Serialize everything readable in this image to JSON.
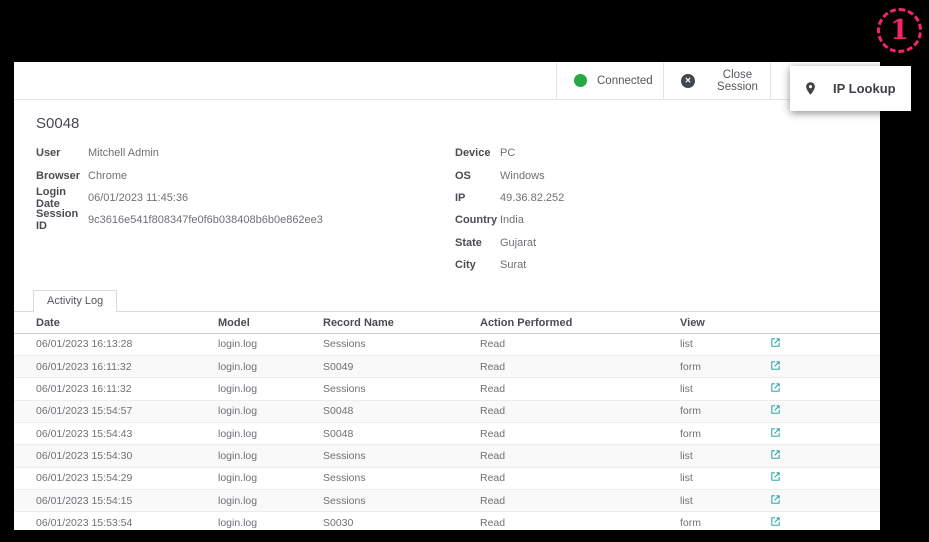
{
  "annotation": {
    "number": "1"
  },
  "toolbar": {
    "connected_label": "Connected",
    "close_session_label": "Close Session",
    "ip_lookup_label": "IP Lookup"
  },
  "popup": {
    "ip_lookup_label": "IP Lookup"
  },
  "session": {
    "title": "S0048",
    "fields_left": [
      {
        "label": "User",
        "value": "Mitchell Admin"
      },
      {
        "label": "Browser",
        "value": "Chrome"
      },
      {
        "label": "Login Date",
        "value": "06/01/2023 11:45:36"
      },
      {
        "label": "Session ID",
        "value": "9c3616e541f808347fe0f6b038408b6b0e862ee3"
      }
    ],
    "fields_right": [
      {
        "label": "Device",
        "value": "PC"
      },
      {
        "label": "OS",
        "value": "Windows"
      },
      {
        "label": "IP",
        "value": "49.36.82.252"
      },
      {
        "label": "Country",
        "value": "India"
      },
      {
        "label": "State",
        "value": "Gujarat"
      },
      {
        "label": "City",
        "value": "Surat"
      }
    ]
  },
  "tabs": {
    "activity_log_label": "Activity Log"
  },
  "activity_log": {
    "columns": {
      "date": "Date",
      "model": "Model",
      "record_name": "Record Name",
      "action_performed": "Action Performed",
      "view": "View"
    },
    "rows": [
      {
        "date": "06/01/2023 16:13:28",
        "model": "login.log",
        "record_name": "Sessions",
        "action": "Read",
        "view": "list"
      },
      {
        "date": "06/01/2023 16:11:32",
        "model": "login.log",
        "record_name": "S0049",
        "action": "Read",
        "view": "form"
      },
      {
        "date": "06/01/2023 16:11:32",
        "model": "login.log",
        "record_name": "Sessions",
        "action": "Read",
        "view": "list"
      },
      {
        "date": "06/01/2023 15:54:57",
        "model": "login.log",
        "record_name": "S0048",
        "action": "Read",
        "view": "form"
      },
      {
        "date": "06/01/2023 15:54:43",
        "model": "login.log",
        "record_name": "S0048",
        "action": "Read",
        "view": "form"
      },
      {
        "date": "06/01/2023 15:54:30",
        "model": "login.log",
        "record_name": "Sessions",
        "action": "Read",
        "view": "list"
      },
      {
        "date": "06/01/2023 15:54:29",
        "model": "login.log",
        "record_name": "Sessions",
        "action": "Read",
        "view": "list"
      },
      {
        "date": "06/01/2023 15:54:15",
        "model": "login.log",
        "record_name": "Sessions",
        "action": "Read",
        "view": "list"
      },
      {
        "date": "06/01/2023 15:53:54",
        "model": "login.log",
        "record_name": "S0030",
        "action": "Read",
        "view": "form"
      }
    ]
  },
  "colors": {
    "connected_green": "#28a745",
    "close_icon_bg": "#43484d",
    "link_icon_teal": "#0e9a96",
    "annotation_pink": "#f2256d"
  }
}
